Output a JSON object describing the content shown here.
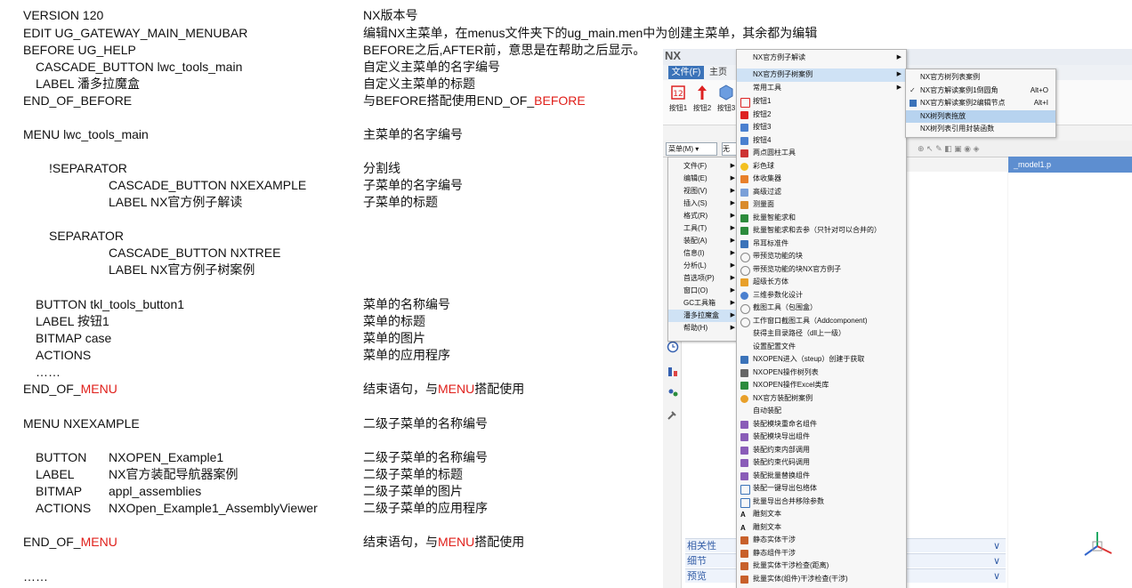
{
  "doc": {
    "left": [
      "VERSION 120",
      "EDIT UG_GATEWAY_MAIN_MENUBAR",
      "BEFORE UG_HELP",
      "CASCADE_BUTTON lwc_tools_main",
      "LABEL 潘多拉魔盒",
      "END_OF_BEFORE",
      "MENU lwc_tools_main",
      "!SEPARATOR",
      "CASCADE_BUTTON NXEXAMPLE",
      "LABEL NX官方例子解读",
      "SEPARATOR",
      "CASCADE_BUTTON NXTREE",
      "LABEL NX官方例子树案例",
      "BUTTON tkl_tools_button1",
      "LABEL 按钮1",
      "BITMAP case",
      "ACTIONS",
      "……",
      "END_OF_",
      "MENU",
      "MENU NXEXAMPLE",
      "BUTTON",
      "NXOPEN_Example1",
      "LABEL",
      "NX官方装配导航器案例",
      "BITMAP",
      "appl_assemblies",
      "ACTIONS",
      "NXOpen_Example1_AssemblyViewer",
      "END_OF_",
      "MENU",
      "……"
    ],
    "right": [
      "NX版本号",
      "编辑NX主菜单，在menus文件夹下的ug_main.men中为创建主菜单，其余都为编辑",
      "BEFORE之后,AFTER前，意思是在帮助之后显示。",
      "自定义主菜单的名字编号",
      "自定义主菜单的标题",
      "与BEFORE搭配使用END_OF_",
      "BEFORE",
      "主菜单的名字编号",
      "分割线",
      "子菜单的名字编号",
      "子菜单的标题",
      "菜单的名称编号",
      "菜单的标题",
      "菜单的图片",
      "菜单的应用程序",
      "结束语句，与",
      "MENU",
      "搭配使用",
      "二级子菜单的名称编号",
      "二级子菜单的名称编号",
      "二级子菜单的标题",
      "二级子菜单的图片",
      "二级子菜单的应用程序",
      "结束语句，与",
      "MENU",
      "搭配使用"
    ]
  },
  "nx": {
    "logo": "NX",
    "file_tab": "文件(F)",
    "main_tab": "主页",
    "ribbon_buttons": [
      "按钮1",
      "按钮2",
      "按钮3"
    ],
    "menu_button": "菜单(M) ▾",
    "filter_label": "无",
    "model_tab": "_model1.p",
    "nav_panels": [
      "相关性",
      "细节",
      "预览"
    ],
    "main_menu": [
      "文件(F)",
      "编辑(E)",
      "视图(V)",
      "插入(S)",
      "格式(R)",
      "工具(T)",
      "装配(A)",
      "信息(I)",
      "分析(L)",
      "首选项(P)",
      "窗口(O)",
      "GC工具箱",
      "潘多拉魔盒",
      "帮助(H)"
    ],
    "custom_menu": [
      "NX官方例子解读",
      "NX官方例子树案例",
      "常用工具",
      "按钮1",
      "按钮2",
      "按钮3",
      "按钮4",
      "两点圆柱工具",
      "彩色球",
      "体收集器",
      "高级过滤",
      "测量面",
      "批量智能求和",
      "批量智能求和去参（只针对可以合并的）",
      "吊耳标准件",
      "带预览功能的块",
      "带预览功能的块NX官方例子",
      "超级长方体",
      "三维参数化设计",
      "截图工具（包围盒）",
      "工作窗口截图工具（Addcomponent)",
      "获得主目录路径（dll上一级）",
      "设置配置文件",
      "NXOPEN进入（steup）创建于获取",
      "NXOPEN操作树列表",
      "NXOPEN操作Excel类库",
      "NX官方装配树案例",
      "自动装配",
      "装配模块重命名组件",
      "装配模块导出组件",
      "装配约束内部调用",
      "装配约束代码调用",
      "装配批量替换组件",
      "装配一键导出包络体",
      "批量导出合并移除参数",
      "雕刻文本",
      "雕刻文本",
      "静态实体干涉",
      "静态组件干涉",
      "批量实体干涉检查(距离)",
      "批量实体(组件)干涉检查(干涉)"
    ],
    "tree_menu": [
      {
        "label": "NX官方树列表案例",
        "shortcut": ""
      },
      {
        "label": "NX官方解读案例1倒圆角",
        "shortcut": "Alt+O"
      },
      {
        "label": "NX官方解读案例2编辑节点",
        "shortcut": "Alt+I"
      },
      {
        "label": "NX树列表拖放",
        "shortcut": ""
      },
      {
        "label": "NX树列表引用封装函数",
        "shortcut": ""
      }
    ],
    "colors": {
      "accent": "#3b73b9",
      "highlight": "#cfe2f5",
      "doc_red": "#e0201b"
    }
  }
}
